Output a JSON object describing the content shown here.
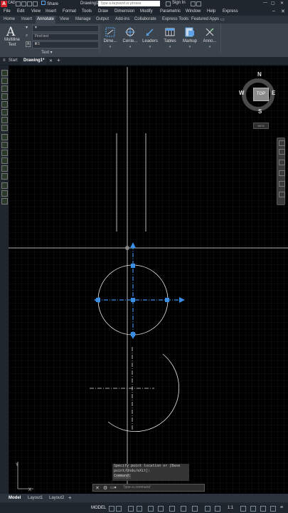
{
  "titlebar": {
    "app_badge": "A",
    "app_label": "CAD",
    "share_label": "Share",
    "doc_title": "Drawing1...",
    "search_placeholder": "Type a keyword or phrase",
    "signin_label": "Sign In"
  },
  "menu": [
    "File",
    "Edit",
    "View",
    "Insert",
    "Format",
    "Tools",
    "Draw",
    "Dimension",
    "Modify",
    "Parametric",
    "Window",
    "Help",
    "Express"
  ],
  "ribbon_tabs": [
    "Home",
    "Insert",
    "Annotate",
    "View",
    "Manage",
    "Output",
    "Add-ins",
    "Collaborate",
    "Express Tools",
    "Featured Apps"
  ],
  "active_ribbon_tab": "Annotate",
  "ribbon": {
    "multiline_text_label": "Multiline Text",
    "find_text_placeholder": "Find text",
    "text_height": "2.5",
    "text_panel_label": "Text",
    "buttons": [
      {
        "label": "Dime...",
        "icon": "dimension-icon"
      },
      {
        "label": "Cente...",
        "icon": "centermark-icon"
      },
      {
        "label": "Leaders",
        "icon": "leader-icon"
      },
      {
        "label": "Tables",
        "icon": "table-icon"
      },
      {
        "label": "Markup",
        "icon": "markup-icon"
      },
      {
        "label": "Anno...",
        "icon": "annotation-scaling-icon"
      }
    ]
  },
  "file_tabs": {
    "start": "Start",
    "active": "Drawing1*",
    "add": "+"
  },
  "viewcube": {
    "top": "TOP",
    "north": "N",
    "south": "S",
    "east": "E",
    "west": "W",
    "wcs": "WCS"
  },
  "ucs": {
    "x": "X",
    "y": "Y"
  },
  "command": {
    "history_line1": "Specify point location or [Base",
    "history_line2": "point/Undo/eXit]:",
    "history_line3": "Command:",
    "placeholder": "Type a command"
  },
  "layout_tabs": [
    "Model",
    "Layout1",
    "Layout2"
  ],
  "active_layout": "Model",
  "layout_add": "+",
  "status": {
    "model_label": "MODEL",
    "scale_label": "1:1"
  },
  "colors": {
    "grip_blue": "#3a8ee6",
    "canvas_bg": "#000000",
    "ribbon_bg": "#3b434d"
  }
}
